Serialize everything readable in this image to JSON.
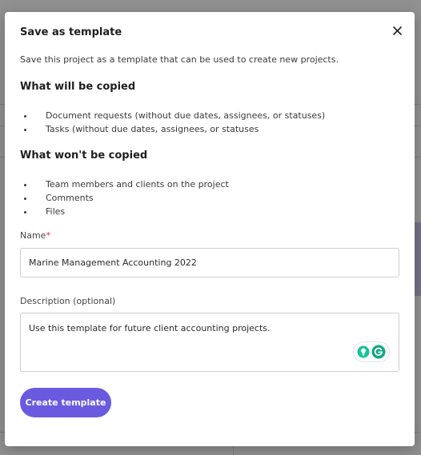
{
  "modal": {
    "title": "Save as template",
    "close_icon": "close-icon",
    "intro": "Save this project as a template that can be used to create new projects.",
    "copied_heading": "What will be copied",
    "copied_items": [
      "Document requests (without due dates, assignees, or statuses)",
      "Tasks (without due dates, assignees, or statuses"
    ],
    "not_copied_heading": "What won't be copied",
    "not_copied_items": [
      "Team members and clients on the project",
      "Comments",
      "Files"
    ],
    "name_label": "Name",
    "name_required_mark": "*",
    "name_value": "Marine Management Accounting 2022",
    "description_label": "Description (optional)",
    "description_value": "Use this template for future client accounting projects.",
    "grammarly_icons": [
      "lightbulb-icon",
      "grammarly-icon"
    ],
    "submit_label": "Create template"
  },
  "colors": {
    "accent": "#6a5ae0",
    "required": "#d9263c",
    "grammarly_green": "#15c39a",
    "grammarly_teal": "#11a683",
    "backdrop": "rgba(0,0,0,0.42)"
  }
}
